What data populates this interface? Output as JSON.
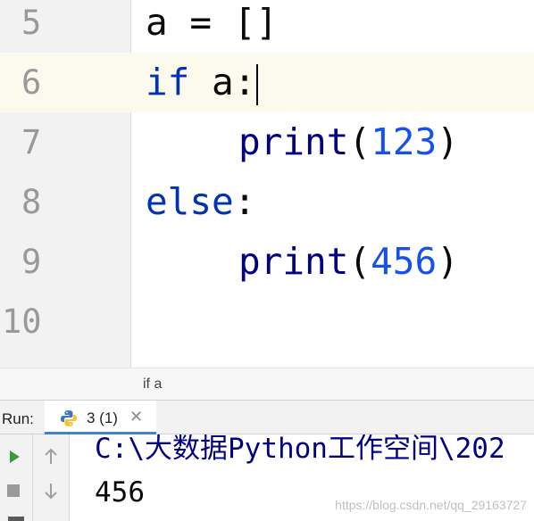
{
  "editor": {
    "current_line": 6,
    "lines": [
      {
        "number": "5",
        "text": "a = []"
      },
      {
        "number": "6",
        "text": "if a:"
      },
      {
        "number": "7",
        "text": "print(123)"
      },
      {
        "number": "8",
        "text": "else:"
      },
      {
        "number": "9",
        "text": "print(456)"
      },
      {
        "number": "10",
        "text": ""
      }
    ],
    "tokens": {
      "line5": "a = []",
      "line6_kw": "if",
      "line6_rest": " a:",
      "line7_fn": "print",
      "line7_open": "(",
      "line7_num": "123",
      "line7_close": ")",
      "line8_kw": "else",
      "line8_rest": ":",
      "line9_fn": "print",
      "line9_open": "(",
      "line9_num": "456",
      "line9_close": ")"
    }
  },
  "breadcrumb": {
    "text": "if a"
  },
  "run_panel": {
    "label": "Run:",
    "tab_label": "3 (1)",
    "close_icon": "close-icon",
    "tab_icon": "python-icon",
    "console": {
      "path_line": "C:\\大数据Python工作空间\\202",
      "output_line": "456"
    },
    "watermark": "https://blog.csdn.net/qq_29163727"
  },
  "colors": {
    "keyword": "#0033b3",
    "builtin": "#000080",
    "number": "#1750eb",
    "current_line": "#fcfaed",
    "run_icon": "#3c9a3c",
    "tab_underline": "#4083c9"
  }
}
